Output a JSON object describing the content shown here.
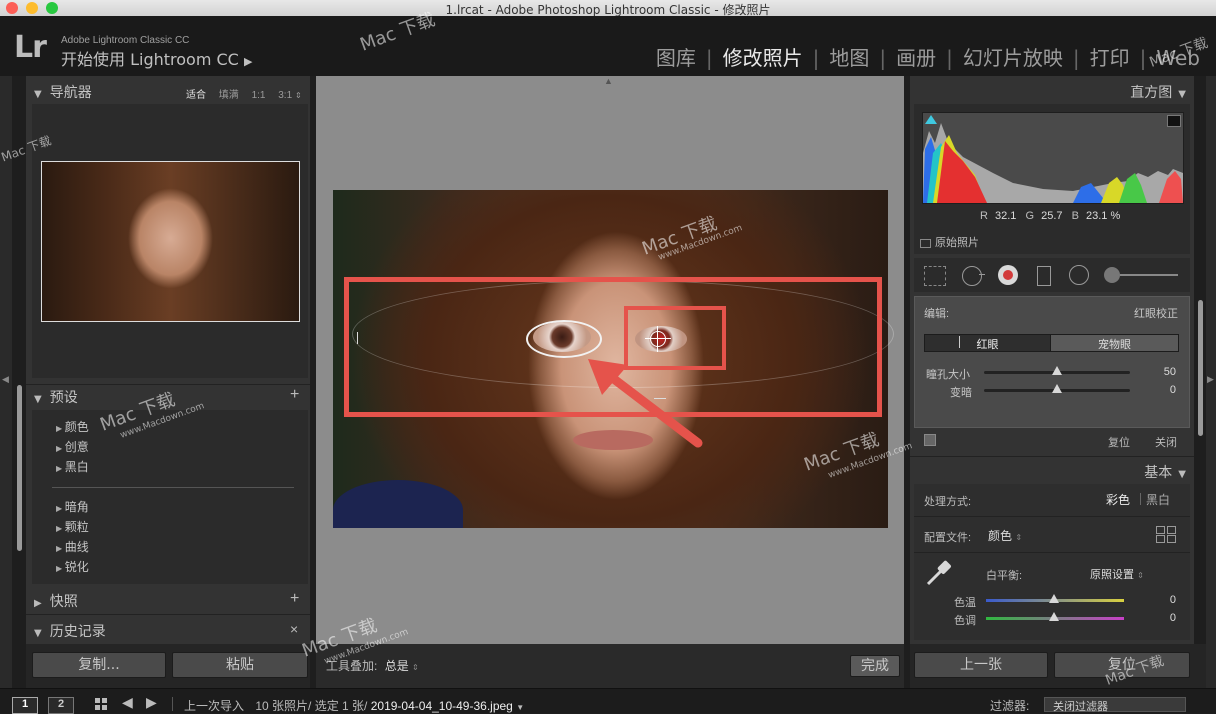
{
  "window": {
    "title": "1.lrcat - Adobe Photoshop Lightroom Classic - 修改照片"
  },
  "brand": {
    "logo": "Lr",
    "product_small": "Adobe Lightroom Classic CC",
    "product_large": "开始使用 Lightroom CC",
    "product_arrow": "▶"
  },
  "modules": [
    "图库",
    "修改照片",
    "地图",
    "画册",
    "幻灯片放映",
    "打印",
    "Web"
  ],
  "active_module": "修改照片",
  "navigator": {
    "title": "导航器",
    "zoom_options": [
      "适合",
      "填满",
      "1:1",
      "3:1"
    ]
  },
  "presets": {
    "title": "预设",
    "add": "+",
    "group1": [
      "颜色",
      "创意",
      "黑白"
    ],
    "group2": [
      "暗角",
      "颗粒",
      "曲线",
      "锐化"
    ]
  },
  "snapshots": {
    "title": "快照",
    "add": "+"
  },
  "history": {
    "title": "历史记录",
    "close": "×"
  },
  "left_buttons": {
    "copy": "复制...",
    "paste": "粘贴"
  },
  "center_toolbar": {
    "overlay_label": "工具叠加:",
    "overlay_value": "总是",
    "done": "完成"
  },
  "histogram": {
    "title": "直方图",
    "r_label": "R",
    "r_value": "32.1",
    "g_label": "G",
    "g_value": "25.7",
    "b_label": "B",
    "b_value": "23.1",
    "percent": "%",
    "original_photo": "原始照片"
  },
  "redeye": {
    "edit_label": "编辑:",
    "title": "红眼校正",
    "tab_redeye": "红眼",
    "tab_pet": "宠物眼",
    "pupil_label": "瞳孔大小",
    "pupil_value": "50",
    "pupil_fraction": 0.5,
    "darken_label": "变暗",
    "darken_value": "0",
    "darken_fraction": 0.5,
    "reset": "复位",
    "close": "关闭"
  },
  "basic": {
    "title": "基本",
    "treatment_label": "处理方式:",
    "color": "彩色",
    "bw": "黑白",
    "profile_label": "配置文件:",
    "profile_value": "颜色",
    "wb_label": "白平衡:",
    "wb_value": "原照设置",
    "temp_label": "色温",
    "temp_value": "0",
    "tint_label": "色调",
    "tint_value": "0"
  },
  "right_buttons": {
    "prev": "上一张",
    "reset": "复位"
  },
  "filmstrip": {
    "page1": "1",
    "page2": "2",
    "source": "上一次导入",
    "count": "10 张照片/ 选定 1 张/",
    "filename": "2019-04-04_10-49-36.jpeg",
    "filter_label": "过滤器:",
    "filter_value": "关闭过滤器"
  },
  "watermark": "Mac 下载",
  "watermark_url": "www.Macdown.com",
  "colors": {
    "annotation_red": "#e5534b",
    "panel_bg": "#3a3a3a",
    "canvas_bg": "#8c8c8c"
  }
}
